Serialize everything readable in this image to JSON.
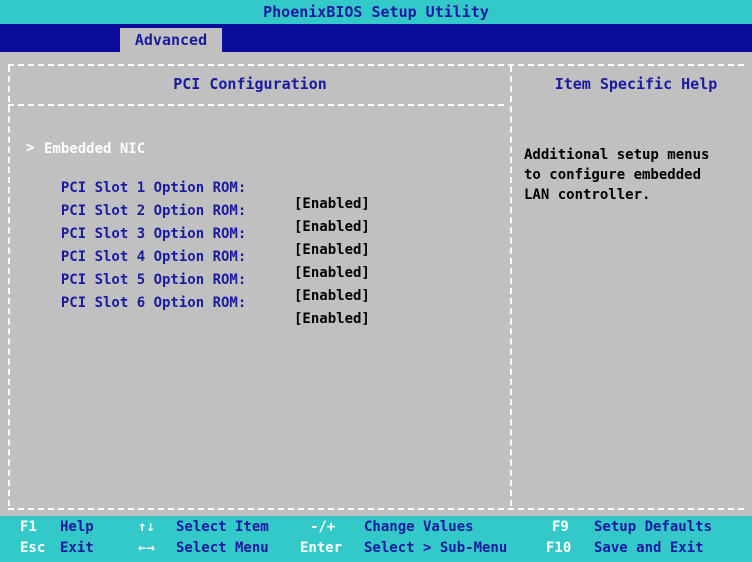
{
  "title": "PhoenixBIOS Setup Utility",
  "menu": {
    "active_tab": "Advanced"
  },
  "panel": {
    "title": "PCI Configuration",
    "submenu_marker": ">",
    "submenu": "Embedded NIC",
    "items": [
      {
        "label": "PCI Slot 1 Option ROM:",
        "value": "[Enabled]"
      },
      {
        "label": "PCI Slot 2 Option ROM:",
        "value": "[Enabled]"
      },
      {
        "label": "PCI Slot 3 Option ROM:",
        "value": "[Enabled]"
      },
      {
        "label": "PCI Slot 4 Option ROM:",
        "value": "[Enabled]"
      },
      {
        "label": "PCI Slot 5 Option ROM:",
        "value": "[Enabled]"
      },
      {
        "label": "PCI Slot 6 Option ROM:",
        "value": "[Enabled]"
      }
    ]
  },
  "help": {
    "title": "Item Specific Help",
    "text": "Additional setup menus\nto configure embedded\nLAN controller."
  },
  "footer": {
    "row1": [
      {
        "key": "F1",
        "action": "Help"
      },
      {
        "key": "↑↓",
        "action": "Select Item"
      },
      {
        "key": "-/+",
        "action": "Change Values"
      },
      {
        "key": "F9",
        "action": "Setup Defaults"
      }
    ],
    "row2": [
      {
        "key": "Esc",
        "action": "Exit"
      },
      {
        "key": "←→",
        "action": "Select Menu"
      },
      {
        "key": "Enter",
        "action": "Select > Sub-Menu"
      },
      {
        "key": "F10",
        "action": "Save and Exit"
      }
    ]
  },
  "colors": {
    "title_bg": "#33c9c9",
    "menu_bg": "#0d0d9c",
    "body_bg": "#c0c0c0",
    "text_blue": "#1a1aa0",
    "highlight": "#ffffff"
  }
}
